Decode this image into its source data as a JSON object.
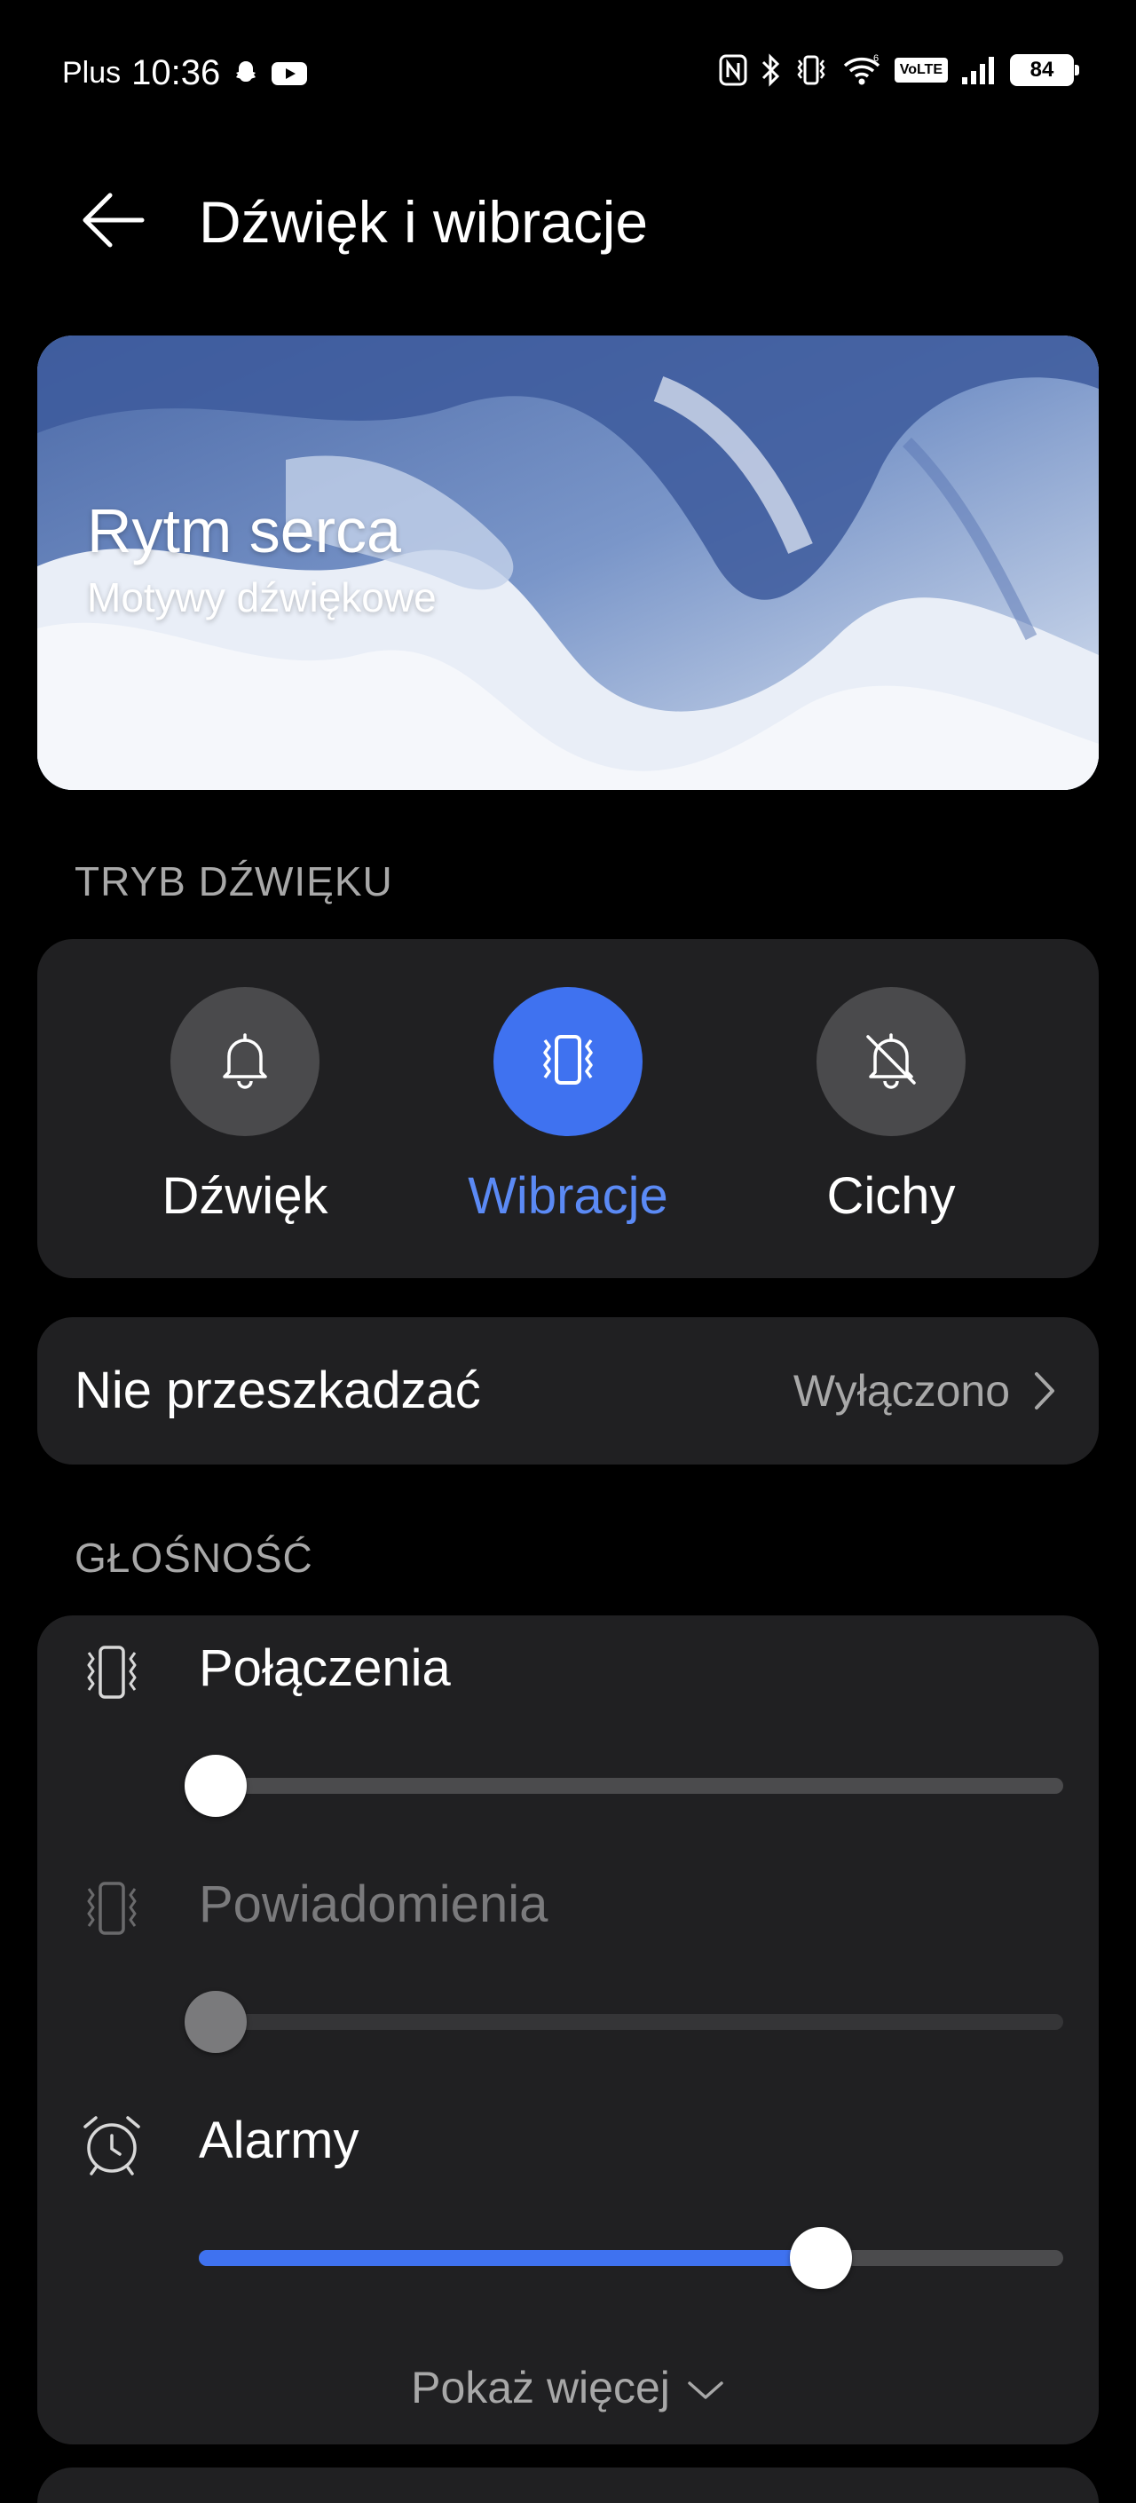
{
  "status_bar": {
    "carrier": "Plus",
    "time": "10:36",
    "network_label": "VoLTE",
    "signal_badge": "6",
    "battery": "84",
    "icons": [
      "snapchat-icon",
      "youtube-icon",
      "nfc-icon",
      "bluetooth-icon",
      "vibrate-icon",
      "wifi-icon",
      "volte-icon",
      "signal-icon",
      "battery-icon"
    ]
  },
  "header": {
    "title": "Dźwięk i wibracje",
    "back_icon": "arrow-left-icon"
  },
  "banner": {
    "title": "Rytm serca",
    "subtitle": "Motywy dźwiękowe"
  },
  "sound_mode": {
    "section_title": "TRYB DŹWIĘKU",
    "options": [
      {
        "label": "Dźwięk",
        "icon": "bell-icon",
        "active": false
      },
      {
        "label": "Wibracje",
        "icon": "vibrate-icon",
        "active": true
      },
      {
        "label": "Cichy",
        "icon": "bell-off-icon",
        "active": false
      }
    ]
  },
  "dnd": {
    "title": "Nie przeszkadzać",
    "value": "Wyłączono"
  },
  "volume": {
    "section_title": "GŁOŚNOŚĆ",
    "rows": [
      {
        "label": "Połączenia",
        "icon": "vibrate-icon",
        "level": 0.02,
        "enabled": true
      },
      {
        "label": "Powiadomienia",
        "icon": "vibrate-icon",
        "level": 0.02,
        "enabled": false
      },
      {
        "label": "Alarmy",
        "icon": "alarm-clock-icon",
        "level": 0.72,
        "enabled": true
      }
    ],
    "show_more": "Pokaż więcej"
  },
  "colors": {
    "accent": "#3f72f0",
    "accent_text": "#5b8af5",
    "card": "#202022",
    "secondary_text": "#a8a8a8"
  }
}
